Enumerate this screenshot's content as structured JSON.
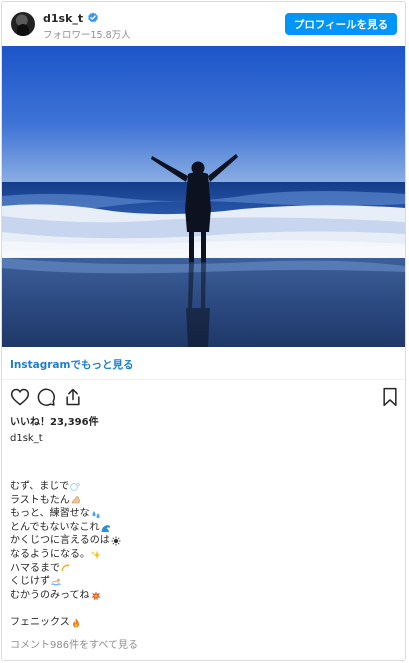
{
  "header": {
    "username": "d1sk_t",
    "followers": "フォロワー15.8万人",
    "profile_button": "プロフィールを見る"
  },
  "see_more": "Instagramでもっと見る",
  "likes": "いいね！23,396件",
  "caption_user": "d1sk_t",
  "caption_lines": [
    {
      "text": "むず、まじで",
      "emoji": "bubble-icon"
    },
    {
      "text": "ラストもたん",
      "emoji": "muscle-icon"
    },
    {
      "text": "もっと、練習せな",
      "emoji": "sweat-icon"
    },
    {
      "text": "とんでもないなこれ",
      "emoji": "wave-icon"
    },
    {
      "text": "かくじつに言えるのは",
      "emoji": "sun-icon"
    },
    {
      "text": "なるようになる。",
      "emoji": "sparkles-icon"
    },
    {
      "text": "ハマるまで",
      "emoji": "dizzy-icon"
    },
    {
      "text": "くじけず",
      "emoji": "swimmer-icon"
    },
    {
      "text": "むかうのみってね",
      "emoji": "boom-icon"
    }
  ],
  "caption_final": {
    "text": "フェニックス",
    "emoji": "fire-icon"
  },
  "comments_link": "コメント986件をすべて見る",
  "colors": {
    "accent": "#0095f6",
    "link": "#1e7fd0",
    "muted": "#8e8e8e",
    "text": "#262626"
  }
}
